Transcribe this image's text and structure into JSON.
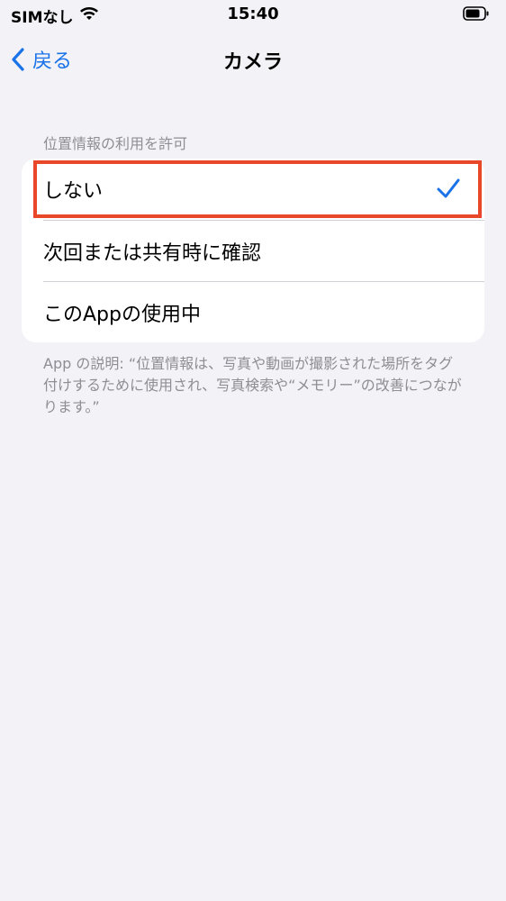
{
  "status_bar": {
    "carrier": "SIMなし",
    "time": "15:40"
  },
  "nav": {
    "back_label": "戻る",
    "title": "カメラ"
  },
  "section": {
    "header": "位置情報の利用を許可",
    "options": [
      {
        "label": "しない",
        "selected": true
      },
      {
        "label": "次回または共有時に確認",
        "selected": false
      },
      {
        "label": "このAppの使用中",
        "selected": false
      }
    ],
    "footer": "App の説明: “位置情報は、写真や動画が撮影された場所をタグ付けするために使用され、写真検索や“メモリー”の改善につながります。”"
  },
  "colors": {
    "accent": "#1a73e8",
    "highlight": "#e8472a",
    "background": "#f2f2f7"
  }
}
